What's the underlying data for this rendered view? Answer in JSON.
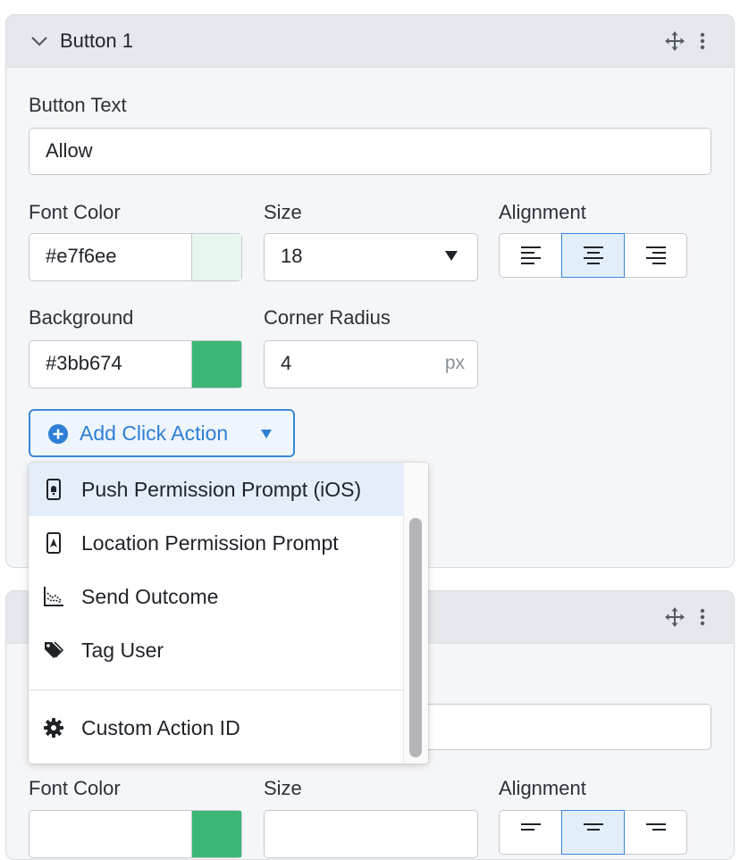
{
  "panel1": {
    "title": "Button 1",
    "button_text": {
      "label": "Button Text",
      "value": "Allow"
    },
    "font_color": {
      "label": "Font Color",
      "value": "#e7f6ee",
      "swatch": "#e7f6ee"
    },
    "size": {
      "label": "Size",
      "value": "18"
    },
    "alignment": {
      "label": "Alignment",
      "options": [
        "left",
        "center",
        "right"
      ],
      "selected": "center"
    },
    "background": {
      "label": "Background",
      "value": "#3bb674",
      "swatch": "#3bb674"
    },
    "corner_radius": {
      "label": "Corner Radius",
      "value": "4",
      "unit": "px"
    },
    "add_click_action": {
      "label": "Add Click Action"
    }
  },
  "dropdown": {
    "items": [
      {
        "label": "Push Permission Prompt (iOS)",
        "icon": "phone-bell-icon",
        "highlighted": true
      },
      {
        "label": "Location Permission Prompt",
        "icon": "phone-location-icon"
      },
      {
        "label": "Send Outcome",
        "icon": "chart-icon"
      },
      {
        "label": "Tag User",
        "icon": "tag-icon"
      },
      {
        "label": "Custom Action ID",
        "icon": "gear-icon"
      }
    ]
  },
  "panel2": {
    "font_color": {
      "label": "Font Color",
      "swatch": "#3bb674"
    },
    "size": {
      "label": "Size"
    },
    "alignment": {
      "label": "Alignment",
      "selected": "center"
    }
  },
  "colors": {
    "accent": "#3a87d9",
    "header_bg": "#e5e8ec",
    "panel_bg": "#f5f6f8"
  }
}
